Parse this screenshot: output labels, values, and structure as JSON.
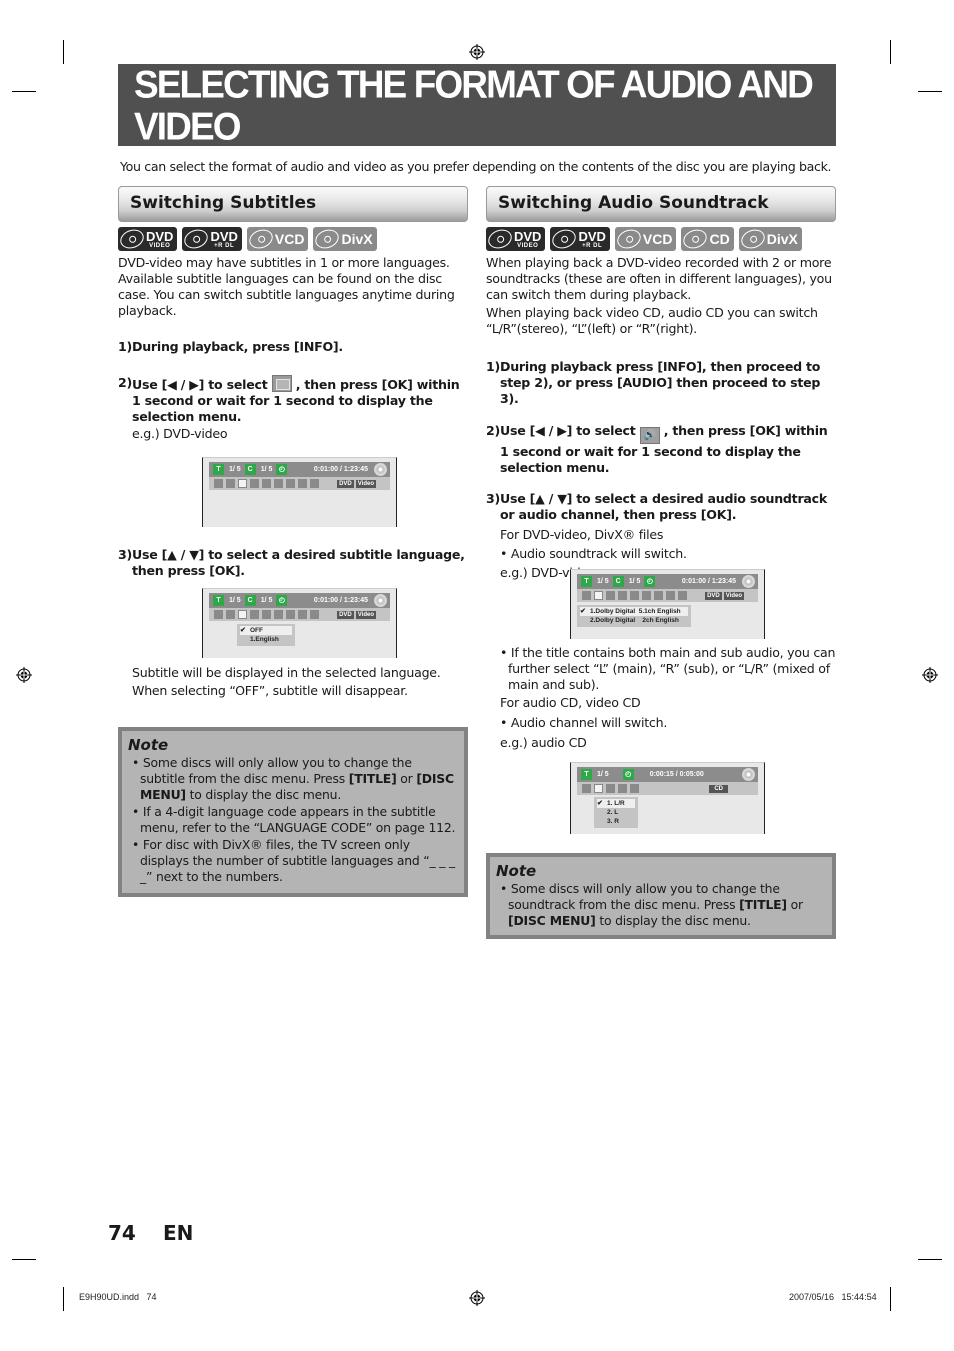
{
  "page": {
    "title": "SELECTING THE FORMAT OF AUDIO AND VIDEO",
    "intro": "You can select the format of audio and video as you prefer depending on the contents of the disc you are playing back.",
    "page_number": "74",
    "language": "EN",
    "footer_file": "E9H90UD.indd   74",
    "footer_timestamp": "2007/05/16   15:44:54"
  },
  "subtitles": {
    "heading": "Switching Subtitles",
    "badges": [
      {
        "main": "DVD",
        "sub": "VIDEO",
        "style": "dark"
      },
      {
        "main": "DVD",
        "sub": "+R DL",
        "style": "dark"
      },
      {
        "main": "VCD",
        "sub": "",
        "style": "grey"
      },
      {
        "main": "DivX",
        "sub": "",
        "style": "grey"
      }
    ],
    "description": "DVD-video may have subtitles in 1 or more languages. Available subtitle languages can be found on the disc case. You can switch subtitle languages anytime during playback.",
    "step1": {
      "num": "1)",
      "text": "During playback, press [INFO]."
    },
    "step2": {
      "num": "2)",
      "text_before": "Use [◀ / ▶] to select ",
      "text_after": " , then press [OK] within 1 second or wait for 1 second to display the selection menu."
    },
    "example1": "e.g.) DVD-video",
    "step3": {
      "num": "3)",
      "text": "Use [▲ / ▼] to select a desired subtitle language, then press [OK]."
    },
    "result1": "Subtitle will be displayed in the selected language.",
    "result2": "When selecting “OFF”, subtitle will disappear.",
    "osd1": {
      "title_icon": "T",
      "title_val": "1/   5",
      "chapter_icon": "C",
      "chapter_val": "1/   5",
      "time": "0:01:00 / 1:23:45",
      "tags": [
        "DVD",
        "Video"
      ]
    },
    "osd2": {
      "title_icon": "T",
      "title_val": "1/   5",
      "chapter_icon": "C",
      "chapter_val": "1/   5",
      "time": "0:01:00 / 1:23:45",
      "tags": [
        "DVD",
        "Video"
      ],
      "menu": [
        {
          "label": "OFF",
          "selected": true
        },
        {
          "label": "1.English",
          "selected": false
        }
      ]
    },
    "note": {
      "heading": "Note",
      "items": [
        {
          "parts": [
            "Some discs will only allow you to change the subtitle from the disc menu. Press ",
            "[TITLE]",
            " or ",
            "[DISC MENU]",
            " to display the disc menu."
          ]
        },
        {
          "parts": [
            "If a 4-digit language code appears in the subtitle menu, refer to the “LANGUAGE CODE” on page 112."
          ]
        },
        {
          "parts": [
            "For disc with DivX® files, the TV screen only displays the number of subtitle languages and “_ _ _ _” next to the numbers."
          ]
        }
      ]
    }
  },
  "audio": {
    "heading": "Switching Audio Soundtrack",
    "badges": [
      {
        "main": "DVD",
        "sub": "VIDEO",
        "style": "dark"
      },
      {
        "main": "DVD",
        "sub": "+R DL",
        "style": "dark"
      },
      {
        "main": "VCD",
        "sub": "",
        "style": "grey"
      },
      {
        "main": "CD",
        "sub": "",
        "style": "grey"
      },
      {
        "main": "DivX",
        "sub": "",
        "style": "grey"
      }
    ],
    "description1": "When playing back a DVD-video recorded with 2 or more soundtracks (these are often in different languages), you can switch them during playback.",
    "description2": "When playing back video CD, audio CD you can switch “L/R”(stereo), “L”(left) or “R”(right).",
    "step1": {
      "num": "1)",
      "text": "During playback press [INFO], then proceed to step 2), or press [AUDIO] then proceed to step 3)."
    },
    "step2": {
      "num": "2)",
      "text_before": "Use [◀ / ▶] to select ",
      "text_after": " , then press [OK] within 1 second or wait for 1 second to display the selection menu."
    },
    "step3": {
      "num": "3)",
      "text": "Use [▲ / ▼] to select a desired audio soundtrack or audio channel, then press [OK]."
    },
    "dvd_label": "For DVD-video, DivX® files",
    "dvd_bullet": "• Audio soundtrack will switch.",
    "example_dvd": "e.g.) DVD-video",
    "main_sub_bullet": "• If the title contains both main and sub audio, you can further select “L” (main), “R” (sub), or “L/R” (mixed of main and sub).",
    "cd_label": "For audio CD, video CD",
    "cd_bullet": "• Audio channel will switch.",
    "example_cd": "e.g.) audio CD",
    "osd_dvd": {
      "title_icon": "T",
      "title_val": "1/   5",
      "chapter_icon": "C",
      "chapter_val": "1/   5",
      "time": "0:01:00 / 1:23:45",
      "tags": [
        "DVD",
        "Video"
      ],
      "menu": [
        {
          "label": "1.Dolby Digital  5.1ch English",
          "selected": true
        },
        {
          "label": "2.Dolby Digital    2ch English",
          "selected": false
        }
      ]
    },
    "osd_cd": {
      "title_icon": "T",
      "title_val": "1/   5",
      "time": "0:00:15 / 0:05:00",
      "tags": [
        "CD"
      ],
      "menu": [
        {
          "label": "1. L/R",
          "selected": true
        },
        {
          "label": "2. L",
          "selected": false
        },
        {
          "label": "3. R",
          "selected": false
        }
      ]
    },
    "note": {
      "heading": "Note",
      "items": [
        {
          "parts": [
            "Some discs will only allow you to change the soundtrack from the disc menu. Press ",
            "[TITLE]",
            " or ",
            "[DISC MENU]",
            " to display the disc menu."
          ]
        }
      ]
    }
  }
}
